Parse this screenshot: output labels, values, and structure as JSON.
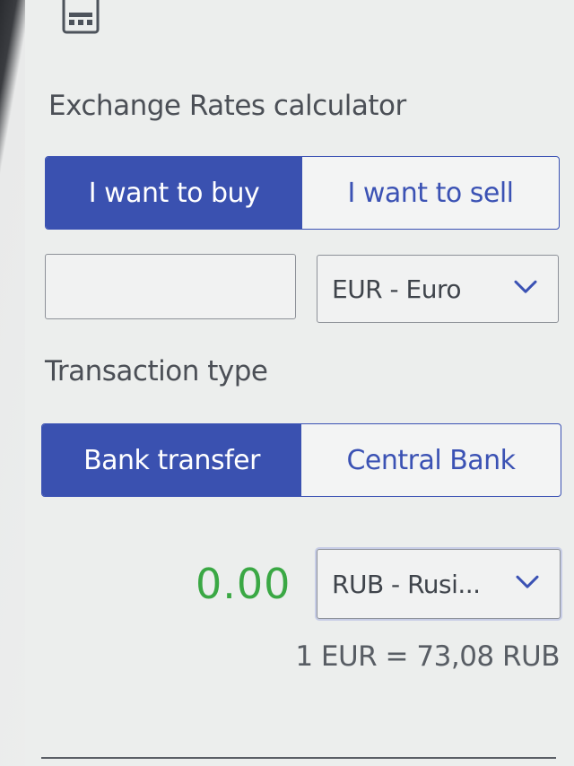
{
  "calculator": {
    "title": "Exchange Rates calculator",
    "mode_tabs": [
      {
        "label": "I want to buy",
        "active": true
      },
      {
        "label": "I want to sell",
        "active": false
      }
    ],
    "amount_input": {
      "value": "",
      "placeholder": ""
    },
    "from_currency": "EUR - Euro",
    "transaction_type_label": "Transaction type",
    "transaction_tabs": [
      {
        "label": "Bank transfer",
        "active": true
      },
      {
        "label": "Central Bank",
        "active": false
      }
    ],
    "result_value": "0.00",
    "to_currency": "RUB - Rusi...",
    "rate_text": "1 EUR = 73,08 RUB"
  },
  "colors": {
    "accent": "#3a51b0",
    "result_green": "#3aa844",
    "text": "#4b4f56"
  },
  "icons": [
    "calculator-icon",
    "chevron-down-icon"
  ]
}
